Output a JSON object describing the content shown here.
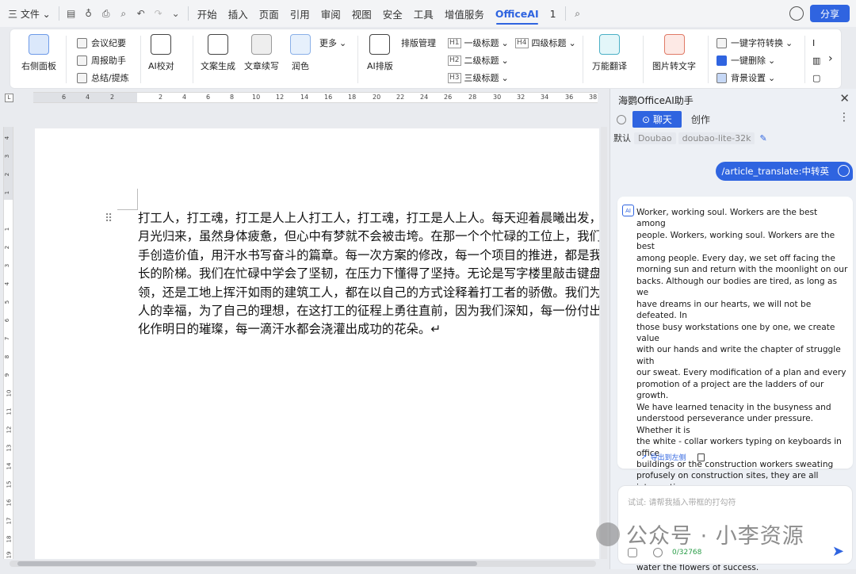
{
  "topbar": {
    "menu_label": "三 文件 ⌄",
    "tabs": [
      "开始",
      "插入",
      "页面",
      "引用",
      "审阅",
      "视图",
      "安全",
      "工具",
      "增值服务",
      "OfficeAI",
      "1"
    ],
    "active_tab": "OfficeAI",
    "share_label": "分享"
  },
  "ribbon": {
    "right_panel": "右侧面板",
    "meeting": "会议纪要",
    "weekly": "周报助手",
    "summary": "总结/提炼",
    "ai_proof": "AI校对",
    "doc_gen": "文案生成",
    "continue_write": "文章续写",
    "polish": "润色",
    "more": "更多",
    "ai_layout": "AI排版",
    "layout_manage": "排版管理",
    "h1": "一级标题",
    "h2": "二级标题",
    "h3": "三级标题",
    "h4": "四级标题",
    "translate": "万能翻译",
    "img2text": "图片转文字",
    "char_convert": "一键字符转换",
    "delete_one": "一键删除",
    "bg_settings": "背景设置"
  },
  "ruler_ticks": [
    "6",
    "4",
    "2",
    "2",
    "4",
    "6",
    "8",
    "10",
    "12",
    "14",
    "16",
    "18",
    "20",
    "22",
    "24",
    "26",
    "28",
    "30",
    "32",
    "34",
    "36",
    "38"
  ],
  "vruler_ticks": [
    "4",
    "3",
    "2",
    "1",
    "1",
    "2",
    "3",
    "4",
    "5",
    "6",
    "7",
    "8",
    "9",
    "10",
    "11",
    "12",
    "13",
    "14",
    "15",
    "16",
    "17",
    "18",
    "19"
  ],
  "document": {
    "lines": [
      "打工人，打工魂，打工是人上人打工人，打工魂，打工是人上人。每天迎着晨曦出发，背",
      "月光归来，虽然身体疲惫，但心中有梦就不会被击垮。在那一个个忙碌的工位上，我们用",
      "手创造价值，用汗水书写奋斗的篇章。每一次方案的修改，每一个项目的推进，都是我们",
      "长的阶梯。我们在忙碌中学会了坚韧，在压力下懂得了坚持。无论是写字楼里敲击键盘的",
      "领，还是工地上挥汗如雨的建筑工人，都在以自己的方式诠释着打工者的骄傲。我们为了",
      "人的幸福，为了自己的理想，在这打工的征程上勇往直前，因为我们深知，每一份付出都",
      "化作明日的璀璨，每一滴汗水都会浇灌出成功的花朵。↵"
    ]
  },
  "panel": {
    "title": "海鹦OfficeAI助手",
    "mode_chat": "⊙ 聊天",
    "mode_create": "创作",
    "model_default": "默认",
    "model_provider": "Doubao",
    "model_name": "doubao-lite-32k",
    "user_message": "/article_translate:中转英",
    "ai_icon_text": "AI",
    "ai_response": "Worker, working soul. Workers are the best among\npeople. Workers, working soul. Workers are the best\namong people. Every day, we set off facing the\nmorning sun and return with the moonlight on our\nbacks. Although our bodies are tired, as long as we\nhave dreams in our hearts, we will not be defeated. In\nthose busy workstations one by one, we create value\nwith our hands and write the chapter of struggle with\nour sweat. Every modification of a plan and every\npromotion of a project are the ladders of our growth.\nWe have learned tenacity in the busyness and\nunderstood perseverance under pressure. Whether it is\nthe white - collar workers typing on keyboards in office\nbuildings or the construction workers sweating\nprofusely on construction sites, they are all interpreting\nthe pride of workers in their own ways. We march\nforward bravely on this journey of working for the\nhappiness of our families and for our own ideals,\nbecause we deeply know that every effort will turn into\ntomorrow's brilliance and every drop of sweat will\nwater the flowers of success.",
    "export_label": "导出到左侧",
    "input_placeholder": "试试: 请帮我插入带框的打勾符",
    "counter": "0/32768"
  },
  "watermark": "公众号 · 小李资源",
  "colors": {
    "accent": "#2f64e0",
    "counter": "#2a9d48"
  }
}
